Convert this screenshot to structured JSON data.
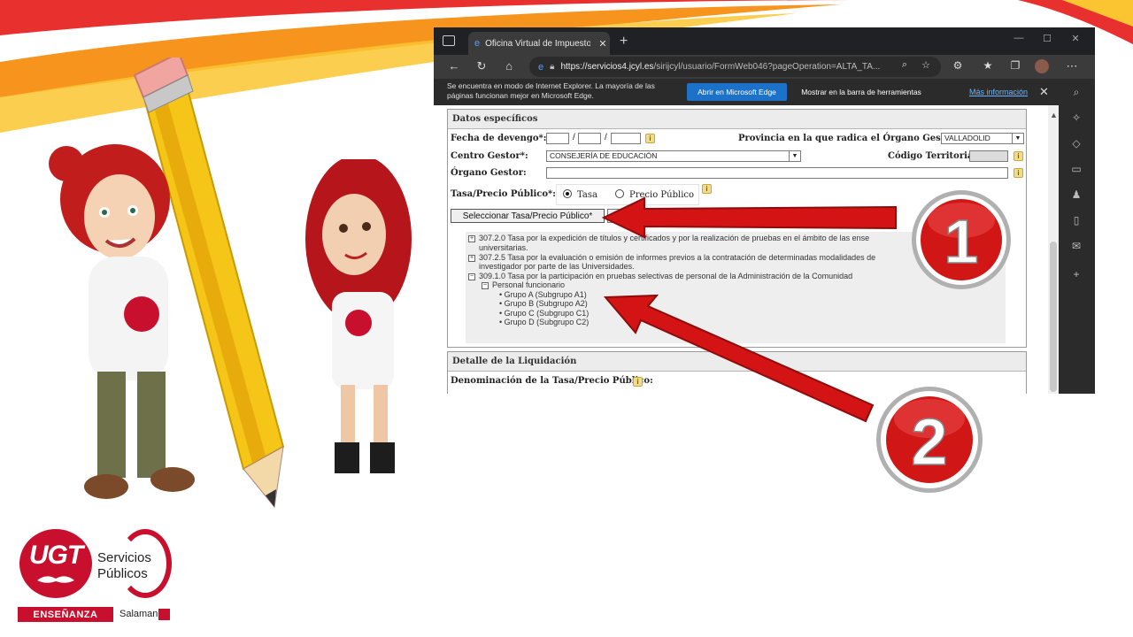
{
  "browser": {
    "tab_title": "Oficina Virtual de Impuestos Aut",
    "tab_close": "✕",
    "new_tab": "+",
    "url_host": "https://servicios4.jcyl.es",
    "url_path": "/sirijcyl/usuario/FormWeb046?pageOperation=ALTA_TA...",
    "window_controls": [
      "—",
      "☐",
      "✕"
    ],
    "nav_icons": [
      "back-icon",
      "refresh-icon",
      "home-icon"
    ],
    "sidebar_icons": [
      "search-icon",
      "sparkle-icon",
      "tag-icon",
      "briefcase-icon",
      "people-icon",
      "office-icon",
      "outlook-icon",
      "add-icon"
    ]
  },
  "infobar": {
    "message": "Se encuentra en modo de Internet Explorer. La mayoría de las páginas funcionan mejor en Microsoft Edge.",
    "open_edge": "Abrir en Microsoft Edge",
    "show_toolbar": "Mostrar en la barra de herramientas",
    "more_info": "Más información",
    "close": "✕"
  },
  "form": {
    "section_title": "Datos específicos",
    "fecha_label": "Fecha de devengo*:",
    "provincia_label": "Provincia en la que radica el Órgano Gestor*:",
    "provincia_value": "VALLADOLID",
    "centro_label": "Centro Gestor*:",
    "centro_value": "CONSEJERÍA DE EDUCACIÓN",
    "codigo_label": "Código Territorial:",
    "organo_label": "Órgano Gestor:",
    "tasa_label": "Tasa/Precio Público*:",
    "radio_tasa": "Tasa",
    "radio_precio": "Precio Público",
    "select_button": "Seleccionar Tasa/Precio Público*",
    "info_glyph": "i",
    "date_sep": "/"
  },
  "tree": [
    {
      "pm": "+",
      "text": "307.2.0 Tasa por la expedición de títulos y certificados y por la realización de pruebas en el ámbito de las ense"
    },
    {
      "pm": "",
      "text": "universitarias."
    },
    {
      "pm": "+",
      "text": "307.2.5 Tasa por la evaluación o emisión de informes previos a la contratación de determinadas modalidades de"
    },
    {
      "pm": "",
      "text": "investigador por parte de las Universidades."
    },
    {
      "pm": "−",
      "text": "309.1.0 Tasa por la participación en pruebas selectivas de personal de la Administración de la Comunidad"
    },
    {
      "pm": "−",
      "text": "Personal funcionario"
    },
    {
      "pm": "",
      "text": "• Grupo A (Subgrupo A1)"
    },
    {
      "pm": "",
      "text": "• Grupo B (Subgrupo A2)"
    },
    {
      "pm": "",
      "text": "• Grupo C (Subgrupo C1)"
    },
    {
      "pm": "",
      "text": "• Grupo D (Subgrupo C2)"
    }
  ],
  "liquidacion": {
    "title": "Detalle de la Liquidación",
    "denominacion_label": "Denominación de la Tasa/Precio Público:"
  },
  "badges": {
    "one": "1",
    "two": "2"
  },
  "logo": {
    "ugt": "UGT",
    "line1": "Servicios",
    "line2": "Públicos",
    "bar": "ENSEÑANZA",
    "city": "Salamanca"
  },
  "colors": {
    "accent_red": "#c8102e",
    "edge_blue": "#1c72c9",
    "arrow_red": "#d41414"
  }
}
